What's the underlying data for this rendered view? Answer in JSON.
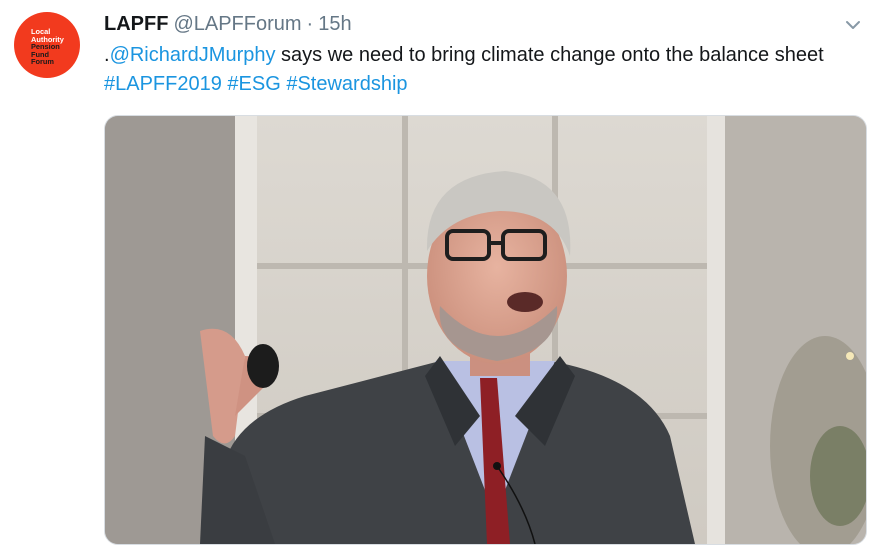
{
  "tweet": {
    "avatar": {
      "lines": [
        {
          "text": "Local",
          "tone": "light"
        },
        {
          "text": "Authority",
          "tone": "light"
        },
        {
          "text": "Pension",
          "tone": "dark"
        },
        {
          "text": "Fund",
          "tone": "dark"
        },
        {
          "text": "Forum",
          "tone": "dark"
        }
      ],
      "background_color": "#f23a1e"
    },
    "display_name": "LAPFF",
    "handle": "@LAPFForum",
    "separator": "·",
    "timestamp": "15h",
    "menu_icon": "chevron-down-icon",
    "text": {
      "prefix": ".",
      "mention": "@RichardJMurphy",
      "body": " says we need to bring climate change onto the balance sheet ",
      "hashtags": [
        "#LAPFF2019",
        "#ESG",
        "#Stewardship"
      ]
    },
    "link_color": "#1b95e0",
    "media": {
      "description_icon": "photo-speaker"
    }
  }
}
